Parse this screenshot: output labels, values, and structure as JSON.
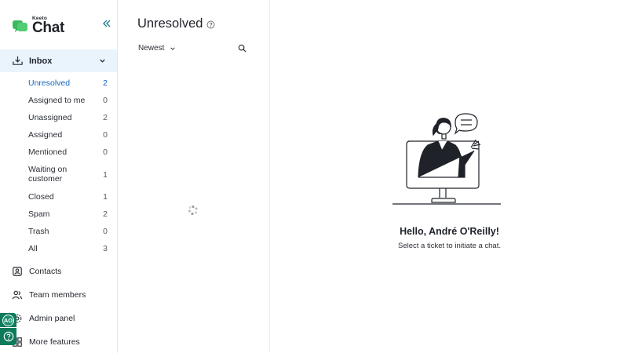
{
  "brand": {
    "small": "Keeto",
    "big": "Chat",
    "color": "#3bb95f"
  },
  "inbox": {
    "label": "Inbox",
    "items": [
      {
        "label": "Unresolved",
        "count": "2",
        "active": true
      },
      {
        "label": "Assigned to me",
        "count": "0"
      },
      {
        "label": "Unassigned",
        "count": "2"
      },
      {
        "label": "Assigned",
        "count": "0"
      },
      {
        "label": "Mentioned",
        "count": "0"
      },
      {
        "label": "Waiting on customer",
        "count": "1"
      },
      {
        "label": "Closed",
        "count": "1"
      },
      {
        "label": "Spam",
        "count": "2"
      },
      {
        "label": "Trash",
        "count": "0"
      },
      {
        "label": "All",
        "count": "3"
      }
    ]
  },
  "nav": {
    "contacts": "Contacts",
    "team_members": "Team members",
    "admin_panel": "Admin panel",
    "more": "More features"
  },
  "user": {
    "initials": "AO"
  },
  "list": {
    "title": "Unresolved",
    "sort_label": "Newest"
  },
  "main": {
    "greeting": "Hello, André O'Reilly!",
    "subtext": "Select a ticket to initiate a chat."
  },
  "colors": {
    "accent": "#1565c0",
    "active_bg": "#eaf4fd",
    "help_bg": "#0e7a5c"
  }
}
